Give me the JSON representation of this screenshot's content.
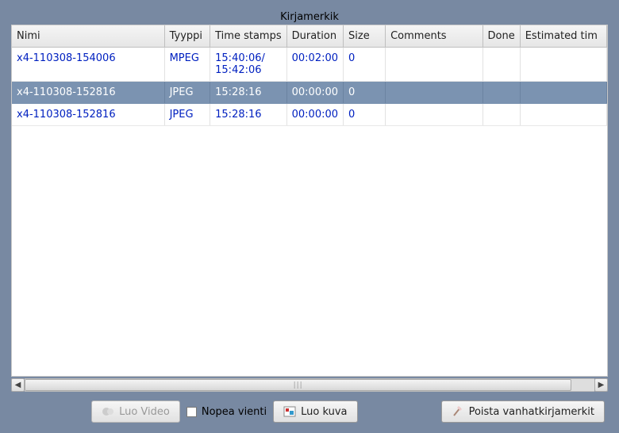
{
  "title": "Kirjamerkik",
  "columns": {
    "name": "Nimi",
    "type": "Tyyppi",
    "timestamps": "Time stamps",
    "duration": "Duration",
    "size": "Size",
    "comments": "Comments",
    "done": "Done",
    "estimated": "Estimated tim"
  },
  "rows": [
    {
      "name": "x4-110308-154006",
      "type": "MPEG",
      "timestamps": "15:40:06/\n15:42:06",
      "duration": "00:02:00",
      "size": "0",
      "comments": "",
      "done": "",
      "estimated": "",
      "selected": false
    },
    {
      "name": "x4-110308-152816",
      "type": "JPEG",
      "timestamps": "15:28:16",
      "duration": "00:00:00",
      "size": "0",
      "comments": "",
      "done": "",
      "estimated": "",
      "selected": true
    },
    {
      "name": "x4-110308-152816",
      "type": "JPEG",
      "timestamps": "15:28:16",
      "duration": "00:00:00",
      "size": "0",
      "comments": "",
      "done": "",
      "estimated": "",
      "selected": false
    }
  ],
  "toolbar": {
    "luo_video": "Luo Video",
    "nopea_vienti": "Nopea vienti",
    "luo_kuva": "Luo kuva",
    "poista": "Poista vanhatkirjamerkit"
  }
}
